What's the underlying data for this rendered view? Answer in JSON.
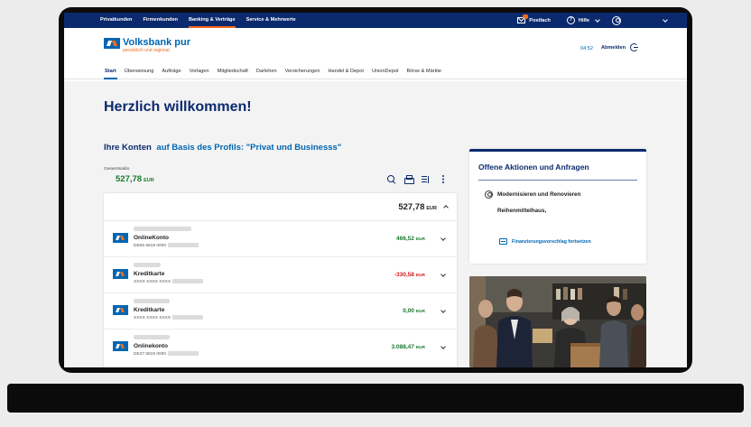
{
  "topnav": {
    "items": [
      "Privatkunden",
      "Firmenkunden",
      "Banking & Verträge",
      "Service & Mehrwerte"
    ],
    "postfach": "Postfach",
    "hilfe": "Hilfe",
    "help_glyph": "?"
  },
  "header": {
    "logo_name": "Volksbank pur",
    "logo_tagline": "persönlich und regional",
    "session_timer": "04:52",
    "logout": "Abmelden"
  },
  "subnav": {
    "items": [
      "Start",
      "Überweisung",
      "Aufträge",
      "Vorlagen",
      "Mitgliedschaft",
      "Darlehen",
      "Versicherungen",
      "Handel & Depot",
      "UnionDepot",
      "Börse & Märkte"
    ]
  },
  "main": {
    "welcome": "Herzlich willkommen!",
    "konten_title": "Ihre Konten",
    "konten_profile": "auf Basis des Profils: \"Privat und Businesss\"",
    "saldo_label": "Gesamtsaldo",
    "saldo_value": "527,78",
    "currency": "EUR",
    "summary_total": "527,78",
    "accounts": [
      {
        "name": "OnlineKonto",
        "iban": "DE05 6619 0000",
        "amount": "466,52",
        "currency": "EUR",
        "sign": "positive"
      },
      {
        "name": "Kreditkarte",
        "iban": "XXXX XXXX XXXX",
        "amount": "-330,58",
        "currency": "EUR",
        "sign": "negative"
      },
      {
        "name": "Kreditkarte",
        "iban": "XXXX XXXX XXXX",
        "amount": "0,00",
        "currency": "EUR",
        "sign": "positive"
      },
      {
        "name": "Onlinekonto",
        "iban": "DE27 6619 0000",
        "amount": "3.088,47",
        "currency": "EUR",
        "sign": "positive"
      }
    ]
  },
  "actions": {
    "title": "Offene Aktionen und Anfragen",
    "item_title": "Modernisieren und Renovieren",
    "item_sub": "Reihenmittelhaus,",
    "link": "Finanzierungsvorschlag fortsetzen"
  },
  "colors": {
    "brand_navy": "#0b2a6e",
    "brand_blue": "#0066b3",
    "brand_orange": "#f26b1d",
    "positive": "#1a7a2e",
    "negative": "#d01a1a"
  }
}
